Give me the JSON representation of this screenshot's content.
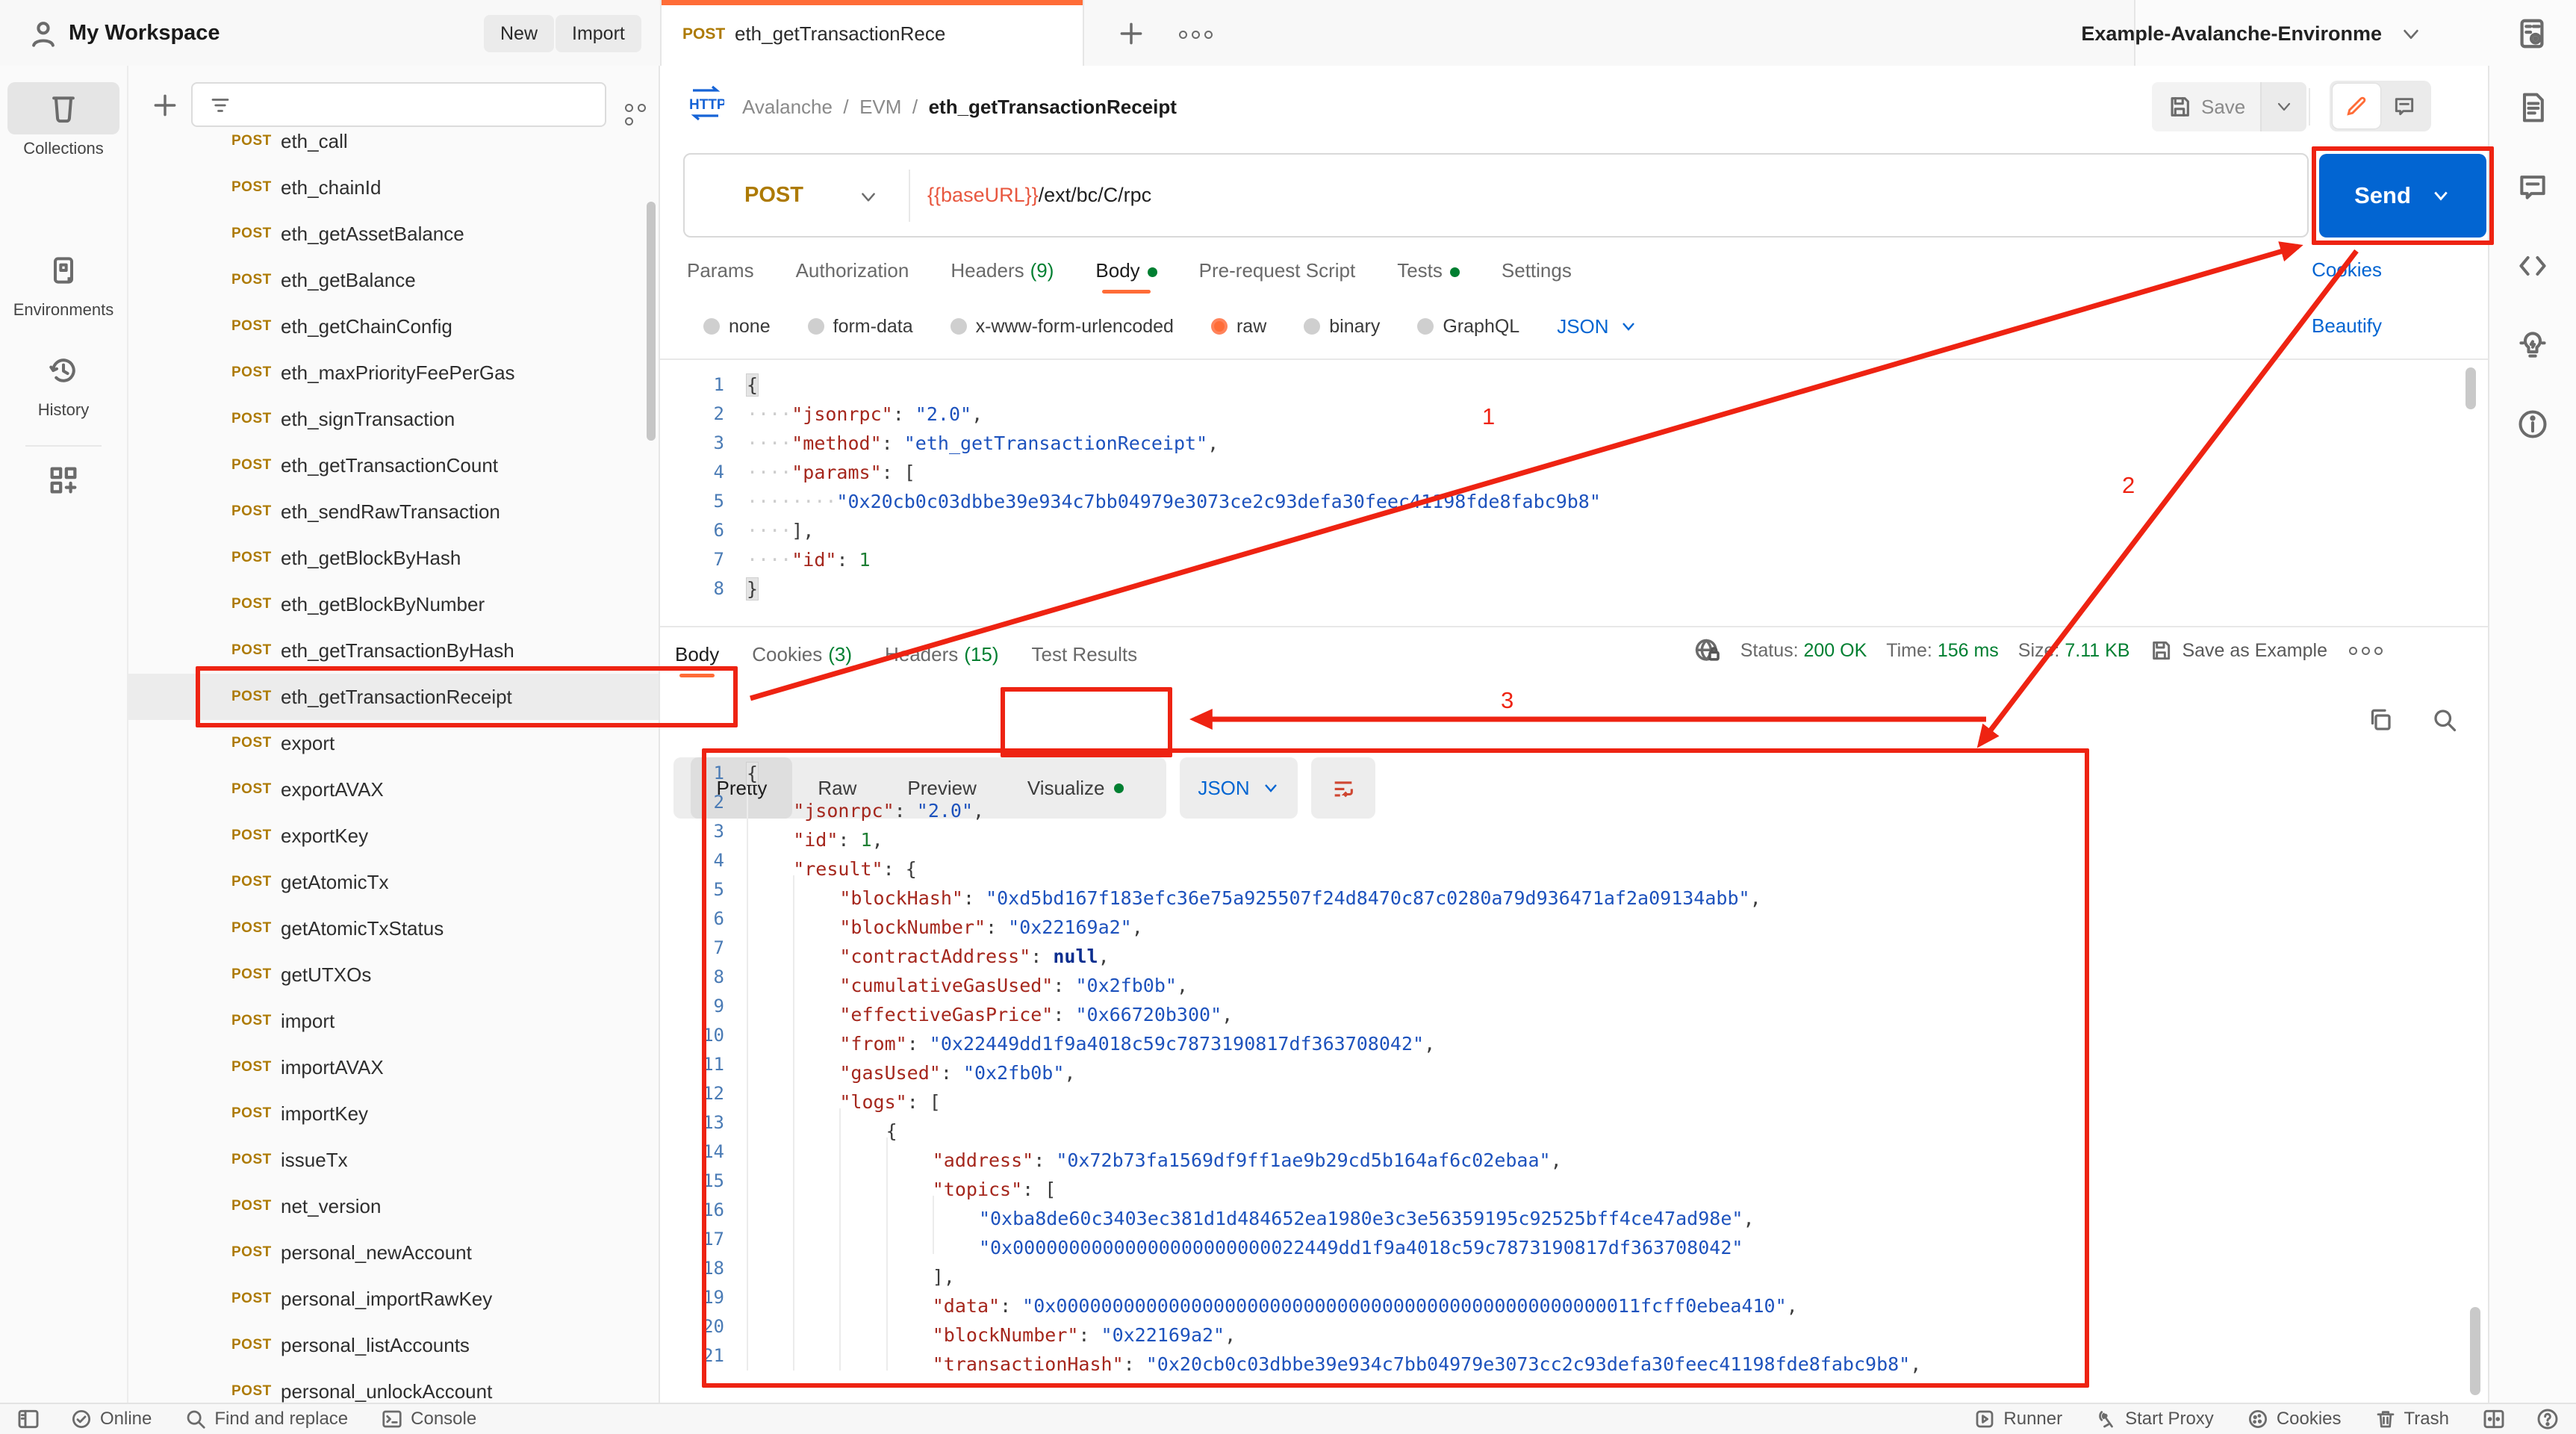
{
  "header": {
    "workspace": "My Workspace",
    "new_button": "New",
    "import_button": "Import",
    "tab": {
      "method": "POST",
      "title": "eth_getTransactionRece"
    },
    "environment": {
      "selected": "Example-Avalanche-Environme"
    }
  },
  "sidebar": {
    "rail": [
      {
        "label": "Collections"
      },
      {
        "label": "Environments"
      },
      {
        "label": "History"
      }
    ],
    "active_index": 12,
    "items": [
      {
        "method": "POST",
        "name": "eth_call"
      },
      {
        "method": "POST",
        "name": "eth_chainId"
      },
      {
        "method": "POST",
        "name": "eth_getAssetBalance"
      },
      {
        "method": "POST",
        "name": "eth_getBalance"
      },
      {
        "method": "POST",
        "name": "eth_getChainConfig"
      },
      {
        "method": "POST",
        "name": "eth_maxPriorityFeePerGas"
      },
      {
        "method": "POST",
        "name": "eth_signTransaction"
      },
      {
        "method": "POST",
        "name": "eth_getTransactionCount"
      },
      {
        "method": "POST",
        "name": "eth_sendRawTransaction"
      },
      {
        "method": "POST",
        "name": "eth_getBlockByHash"
      },
      {
        "method": "POST",
        "name": "eth_getBlockByNumber"
      },
      {
        "method": "POST",
        "name": "eth_getTransactionByHash"
      },
      {
        "method": "POST",
        "name": "eth_getTransactionReceipt"
      },
      {
        "method": "POST",
        "name": "export"
      },
      {
        "method": "POST",
        "name": "exportAVAX"
      },
      {
        "method": "POST",
        "name": "exportKey"
      },
      {
        "method": "POST",
        "name": "getAtomicTx"
      },
      {
        "method": "POST",
        "name": "getAtomicTxStatus"
      },
      {
        "method": "POST",
        "name": "getUTXOs"
      },
      {
        "method": "POST",
        "name": "import"
      },
      {
        "method": "POST",
        "name": "importAVAX"
      },
      {
        "method": "POST",
        "name": "importKey"
      },
      {
        "method": "POST",
        "name": "issueTx"
      },
      {
        "method": "POST",
        "name": "net_version"
      },
      {
        "method": "POST",
        "name": "personal_newAccount"
      },
      {
        "method": "POST",
        "name": "personal_importRawKey"
      },
      {
        "method": "POST",
        "name": "personal_listAccounts"
      },
      {
        "method": "POST",
        "name": "personal_unlockAccount"
      }
    ]
  },
  "request": {
    "breadcrumb": {
      "badge": "HTTP",
      "parts": [
        "Avalanche",
        "EVM"
      ],
      "separator": "/",
      "current": "eth_getTransactionReceipt"
    },
    "save_label": "Save",
    "method": "POST",
    "url_variable": "{{baseURL}}",
    "url_path": "/ext/bc/C/rpc",
    "send_label": "Send",
    "tabs": [
      {
        "label": "Params"
      },
      {
        "label": "Authorization"
      },
      {
        "label": "Headers",
        "badge": "(9)"
      },
      {
        "label": "Body",
        "dot": true,
        "active": true
      },
      {
        "label": "Pre-request Script"
      },
      {
        "label": "Tests",
        "dot": true
      },
      {
        "label": "Settings"
      }
    ],
    "cookies_link": "Cookies",
    "body_modes": [
      {
        "label": "none"
      },
      {
        "label": "form-data"
      },
      {
        "label": "x-www-form-urlencoded"
      },
      {
        "label": "raw",
        "selected": true
      },
      {
        "label": "binary"
      },
      {
        "label": "GraphQL"
      }
    ],
    "language": "JSON",
    "beautify_link": "Beautify",
    "code_lines": [
      "{",
      "    \"jsonrpc\": \"2.0\",",
      "    \"method\": \"eth_getTransactionReceipt\",",
      "    \"params\": [",
      "        \"0x20cb0c03dbbe39e934c7bb04979e3073ce2c93defa30feec41198fde8fabc9b8\"",
      "    ],",
      "    \"id\": 1",
      "}"
    ]
  },
  "response": {
    "tabs": [
      {
        "label": "Body",
        "active": true
      },
      {
        "label": "Cookies",
        "badge": "(3)"
      },
      {
        "label": "Headers",
        "badge": "(15)"
      },
      {
        "label": "Test Results"
      }
    ],
    "meta": {
      "status_label": "Status:",
      "status_value": "200 OK",
      "time_label": "Time:",
      "time_value": "156 ms",
      "size_label": "Size:",
      "size_value": "7.11 KB",
      "save_as_example": "Save as Example"
    },
    "view_tabs": [
      {
        "label": "Pretty",
        "active": true
      },
      {
        "label": "Raw"
      },
      {
        "label": "Preview"
      },
      {
        "label": "Visualize",
        "dot": true
      }
    ],
    "language": "JSON",
    "code_lines": [
      "{",
      "    \"jsonrpc\": \"2.0\",",
      "    \"id\": 1,",
      "    \"result\": {",
      "        \"blockHash\": \"0xd5bd167f183efc36e75a925507f24d8470c87c0280a79d936471af2a09134abb\",",
      "        \"blockNumber\": \"0x22169a2\",",
      "        \"contractAddress\": null,",
      "        \"cumulativeGasUsed\": \"0x2fb0b\",",
      "        \"effectiveGasPrice\": \"0x66720b300\",",
      "        \"from\": \"0x22449dd1f9a4018c59c7873190817df363708042\",",
      "        \"gasUsed\": \"0x2fb0b\",",
      "        \"logs\": [",
      "            {",
      "                \"address\": \"0x72b73fa1569df9ff1ae9b29cd5b164af6c02ebaa\",",
      "                \"topics\": [",
      "                    \"0xba8de60c3403ec381d1d484652ea1980e3c3e56359195c92525bff4ce47ad98e\",",
      "                    \"0x00000000000000000000000022449dd1f9a4018c59c7873190817df363708042\"",
      "                ],",
      "                \"data\": \"0x0000000000000000000000000000000000000000000000000011fcff0ebea410\",",
      "                \"blockNumber\": \"0x22169a2\",",
      "                \"transactionHash\": \"0x20cb0c03dbbe39e934c7bb04979e3073cc2c93defa30feec41198fde8fabc9b8\","
    ]
  },
  "status_bar": {
    "left": [
      {
        "icon": "check-circle",
        "label": "Online"
      },
      {
        "icon": "search",
        "label": "Find and replace"
      },
      {
        "icon": "terminal",
        "label": "Console"
      }
    ],
    "right": [
      {
        "icon": "runner",
        "label": "Runner"
      },
      {
        "icon": "antenna",
        "label": "Start Proxy"
      },
      {
        "icon": "cookie",
        "label": "Cookies"
      },
      {
        "icon": "trash",
        "label": "Trash"
      }
    ]
  },
  "annotations": {
    "steps": [
      "1",
      "2",
      "3"
    ]
  },
  "colors": {
    "accent_orange": "#ff6c37",
    "primary_blue": "#0265d2",
    "success_green": "#007f31",
    "post_method": "#ad7a03",
    "annotation_red": "#ee2312"
  }
}
